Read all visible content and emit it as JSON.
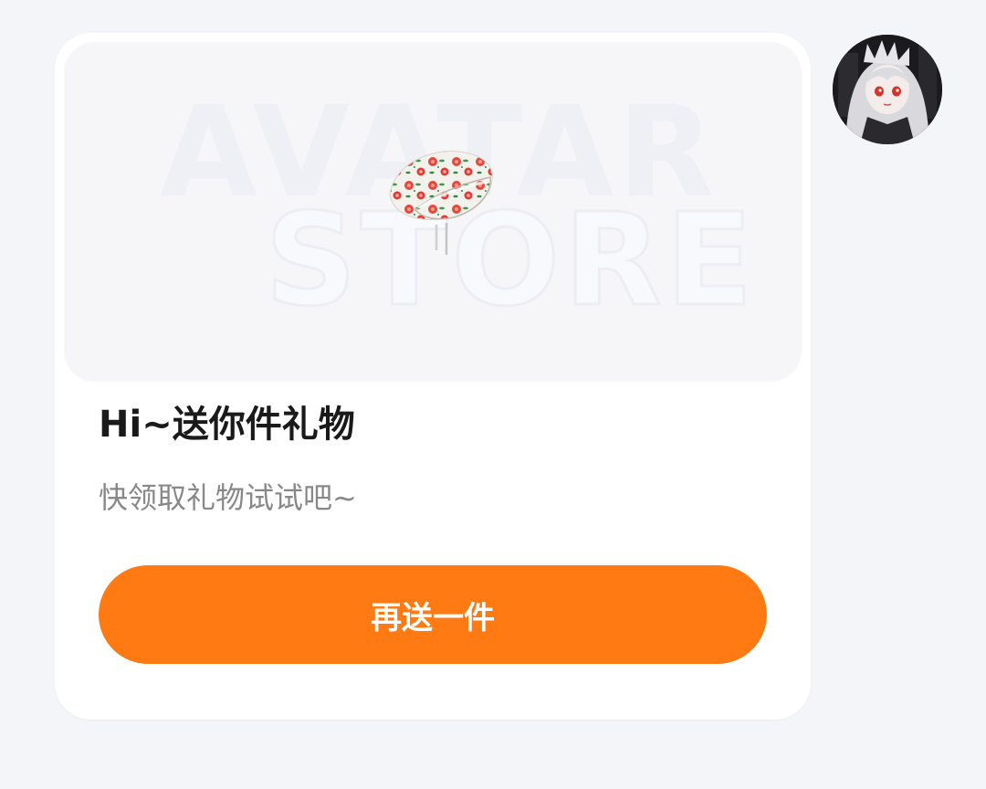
{
  "gift_card": {
    "watermark_line1": "AVATAR",
    "watermark_line2": "STORE",
    "gift_image": "floral-hat-gift-image",
    "title": "Hi~送你件礼物",
    "subtitle": "快领取礼物试试吧~",
    "button_label": "再送一件"
  },
  "sender": {
    "avatar": "anime-girl-avatar"
  },
  "colors": {
    "background": "#f4f5f8",
    "card": "#ffffff",
    "banner": "#f6f6f9",
    "button": "#ff7a13",
    "button_text": "#ffffff",
    "title": "#1a1a1a",
    "subtitle": "#888888"
  }
}
